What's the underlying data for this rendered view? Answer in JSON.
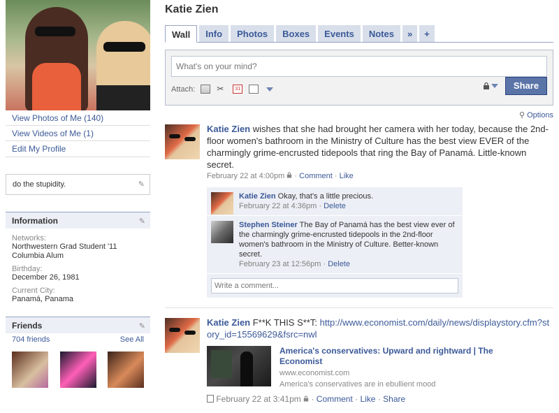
{
  "profile": {
    "name": "Katie Zien"
  },
  "left": {
    "links": [
      "View Photos of Me (140)",
      "View Videos of Me (1)",
      "Edit My Profile"
    ],
    "status": "do the stupidity.",
    "information": {
      "heading": "Information",
      "networks_label": "Networks:",
      "networks": [
        "Northwestern Grad Student '11",
        "Columbia Alum"
      ],
      "birthday_label": "Birthday:",
      "birthday": "December 26, 1981",
      "city_label": "Current City:",
      "city": "Panamá, Panama"
    },
    "friends": {
      "heading": "Friends",
      "count": "704 friends",
      "see_all": "See All"
    }
  },
  "tabs": [
    "Wall",
    "Info",
    "Photos",
    "Boxes",
    "Events",
    "Notes",
    "»",
    "+"
  ],
  "publisher": {
    "placeholder": "What's on your mind?",
    "attach_label": "Attach:",
    "share_label": "Share"
  },
  "options_label": "Options",
  "stories": [
    {
      "actor": "Katie Zien",
      "text": " wishes that she had brought her camera with her today, because the 2nd-floor women's bathroom in the Ministry of Culture has the best view EVER of the charmingly grime-encrusted tidepools that ring the Bay of Panamá. Little-known secret.",
      "time": "February 22 at 4:00pm",
      "comment_link": "Comment",
      "like_link": "Like",
      "comments": [
        {
          "name": "Katie Zien",
          "text": " Okay, that's a little precious.",
          "time": "February 22 at 4:36pm",
          "delete": "Delete"
        },
        {
          "name": "Stephen Steiner",
          "text": " The Bay of Panamá has the best view ever of the charmingly grime-encrusted tidepools in the 2nd-floor women's bathroom in the Ministry of Culture. Better-known secret.",
          "time": "February 23 at 12:56pm",
          "delete": "Delete"
        }
      ],
      "comment_placeholder": "Write a comment..."
    },
    {
      "actor": "Katie Zien",
      "text": " F**K THIS S**T: ",
      "url": "http://www.economist.com/daily/news/displaystory.cfm?story_id=15569629&fsrc=nwl",
      "attachment": {
        "title": "America's conservatives: Upward and rightward | The Economist",
        "domain": "www.economist.com",
        "caption": "America's conservatives are in ebullient mood"
      },
      "time": "February 22 at 3:41pm",
      "comment_link": "Comment",
      "like_link": "Like",
      "share_link": "Share"
    }
  ],
  "colors": {
    "link": "#3b5998",
    "tab_bg": "#d8dfea",
    "share_btn": "#5b74a8",
    "box_head": "#eceff5"
  }
}
